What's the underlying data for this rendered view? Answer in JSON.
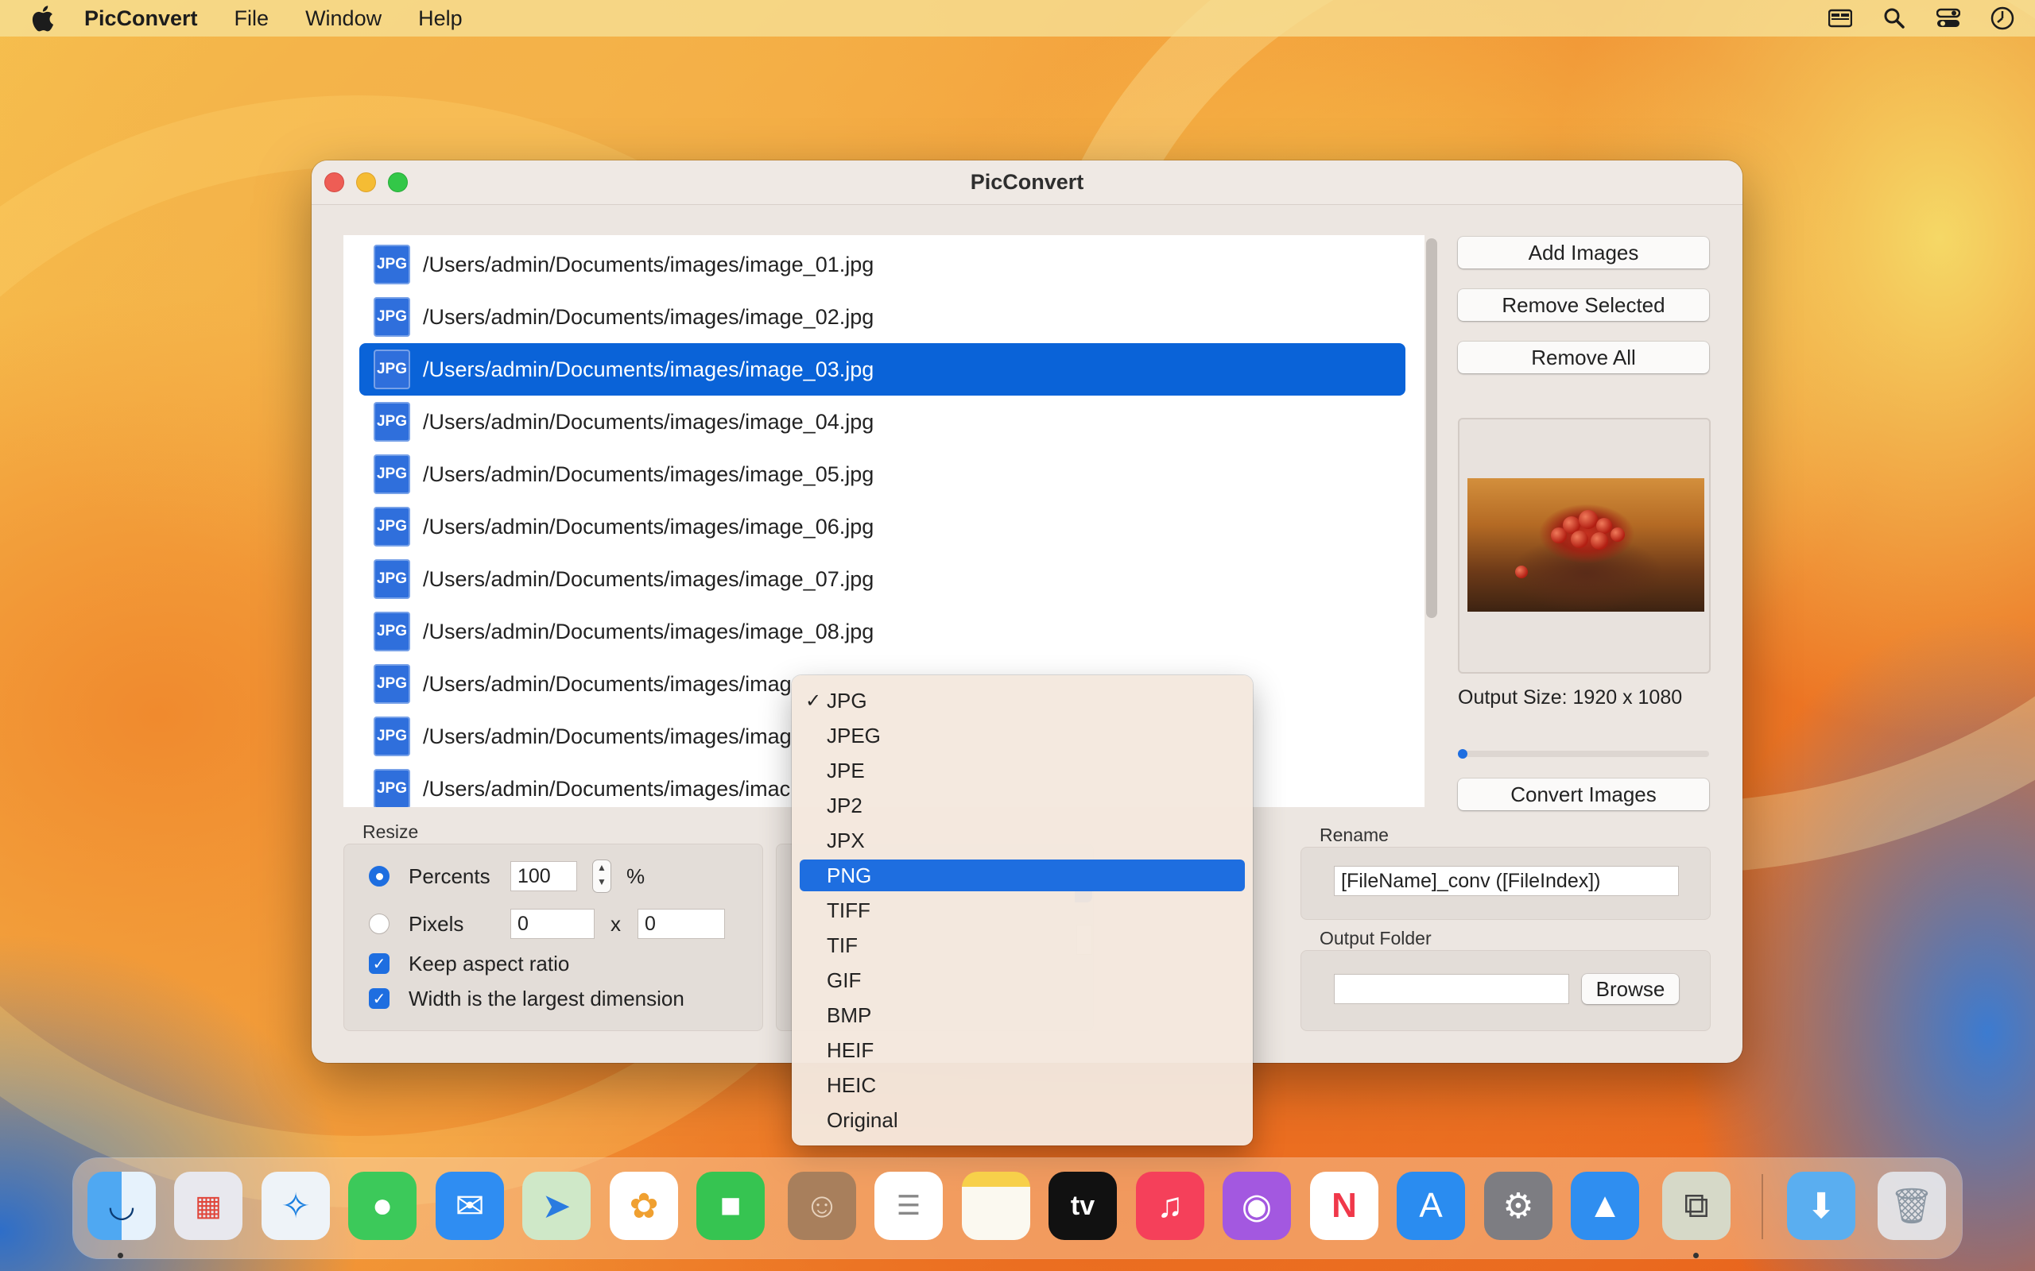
{
  "menubar": {
    "app_name": "PicConvert",
    "items": [
      "File",
      "Window",
      "Help"
    ],
    "icons": [
      "apple-logo-icon",
      "display-icon",
      "search-icon",
      "control-center-icon",
      "clock-icon"
    ]
  },
  "window": {
    "title": "PicConvert",
    "files": [
      "/Users/admin/Documents/images/image_01.jpg",
      "/Users/admin/Documents/images/image_02.jpg",
      "/Users/admin/Documents/images/image_03.jpg",
      "/Users/admin/Documents/images/image_04.jpg",
      "/Users/admin/Documents/images/image_05.jpg",
      "/Users/admin/Documents/images/image_06.jpg",
      "/Users/admin/Documents/images/image_07.jpg",
      "/Users/admin/Documents/images/image_08.jpg",
      "/Users/admin/Documents/images/imag",
      "/Users/admin/Documents/images/imag",
      "/Users/admin/Documents/images/imac"
    ],
    "file_badge": "JPG",
    "selected_index": 2,
    "buttons": {
      "add": "Add Images",
      "remove_selected": "Remove Selected",
      "remove_all": "Remove All",
      "convert": "Convert Images"
    },
    "output_size": "Output Size: 1920 x 1080",
    "resize": {
      "label": "Resize",
      "percents_label": "Percents",
      "percents_value": "100",
      "percent_sign": "%",
      "pixels_label": "Pixels",
      "pixels_w": "0",
      "pixels_x": "x",
      "pixels_h": "0",
      "keep_aspect": "Keep aspect ratio",
      "width_largest": "Width is the largest dimension"
    },
    "rename": {
      "label": "Rename",
      "value": "[FileName]_conv ([FileIndex])"
    },
    "output_folder": {
      "label": "Output Folder",
      "value": "",
      "browse": "Browse"
    }
  },
  "format_menu": {
    "options": [
      "JPG",
      "JPEG",
      "JPE",
      "JP2",
      "JPX",
      "PNG",
      "TIFF",
      "TIF",
      "GIF",
      "BMP",
      "HEIF",
      "HEIC",
      "Original"
    ],
    "checked": "JPG",
    "highlighted": "PNG",
    "check_glyph": "✓"
  },
  "dock": {
    "apps": [
      "finder-icon",
      "launchpad-icon",
      "safari-icon",
      "messages-icon",
      "mail-icon",
      "maps-icon",
      "photos-icon",
      "facetime-icon",
      "contacts-icon",
      "reminders-icon",
      "notes-icon",
      "apple-tv-icon",
      "music-icon",
      "podcasts-icon",
      "news-icon",
      "app-store-icon",
      "system-settings-icon",
      "altitude-app-icon",
      "picconvert-app-icon",
      "downloads-folder-icon",
      "trash-icon"
    ],
    "tv_label": "tv"
  }
}
